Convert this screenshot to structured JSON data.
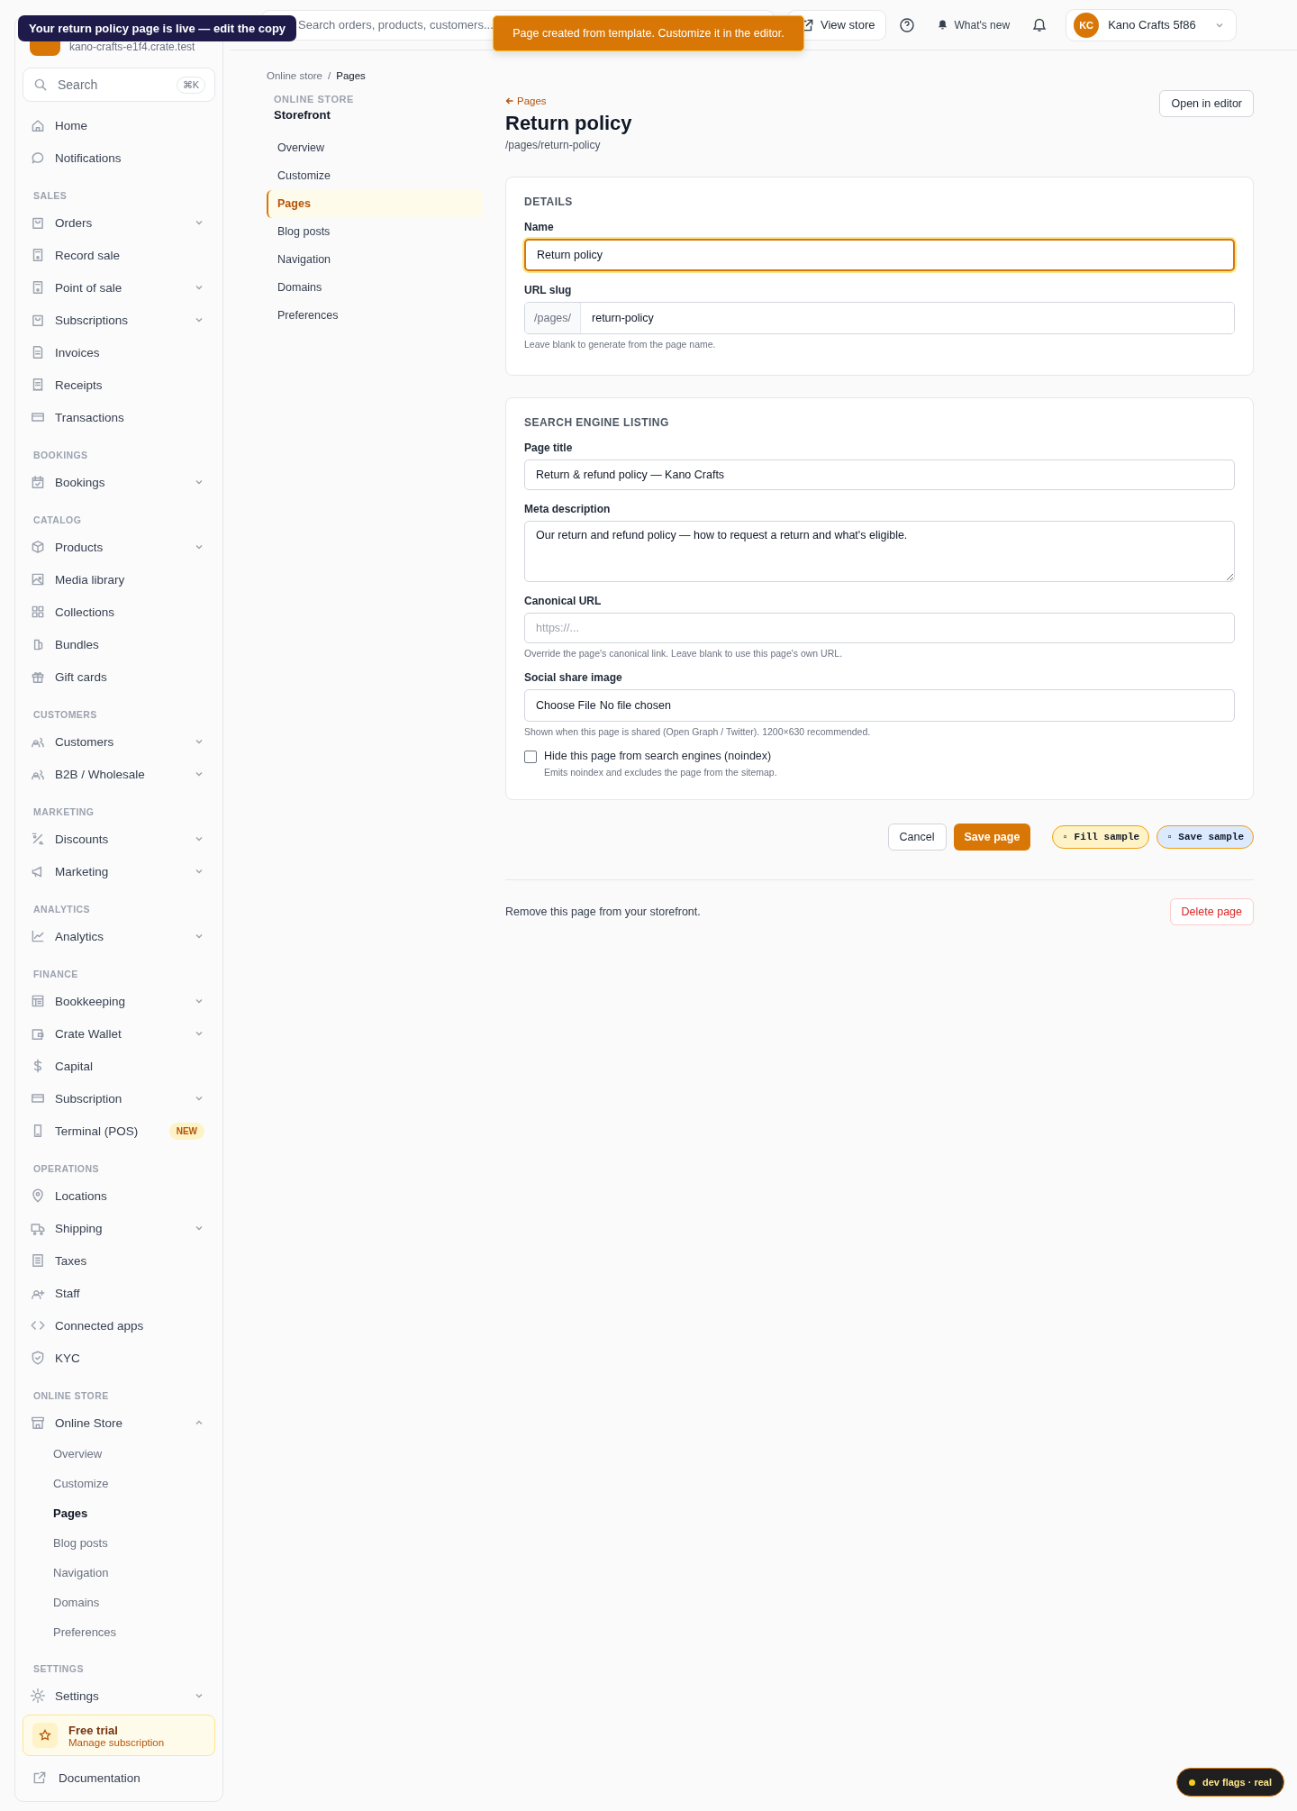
{
  "sidebar": {
    "store_url": "kano-crafts-e1f4.crate.test",
    "search": {
      "placeholder": "Search",
      "shortcut": "⌘K"
    },
    "items": [
      {
        "label": "Home",
        "kind": "link"
      },
      {
        "label": "Notifications",
        "kind": "link"
      }
    ],
    "sections": [
      {
        "title": "SALES",
        "items": [
          {
            "label": "Orders",
            "kind": "menu",
            "expanded": false
          },
          {
            "label": "Record sale",
            "kind": "link"
          },
          {
            "label": "Point of sale",
            "kind": "menu",
            "expanded": false
          },
          {
            "label": "Subscriptions",
            "kind": "menu",
            "expanded": false
          },
          {
            "label": "Invoices",
            "kind": "link"
          },
          {
            "label": "Receipts",
            "kind": "link"
          },
          {
            "label": "Transactions",
            "kind": "link"
          }
        ]
      },
      {
        "title": "BOOKINGS",
        "items": [
          {
            "label": "Bookings",
            "kind": "menu",
            "expanded": false
          }
        ]
      },
      {
        "title": "CATALOG",
        "items": [
          {
            "label": "Products",
            "kind": "menu",
            "expanded": false
          },
          {
            "label": "Media library",
            "kind": "link"
          },
          {
            "label": "Collections",
            "kind": "link"
          },
          {
            "label": "Bundles",
            "kind": "link"
          },
          {
            "label": "Gift cards",
            "kind": "link"
          }
        ]
      },
      {
        "title": "CUSTOMERS",
        "items": [
          {
            "label": "Customers",
            "kind": "menu",
            "expanded": false
          },
          {
            "label": "B2B / Wholesale",
            "kind": "menu",
            "expanded": false
          }
        ]
      },
      {
        "title": "MARKETING",
        "items": [
          {
            "label": "Discounts",
            "kind": "menu",
            "expanded": false
          },
          {
            "label": "Marketing",
            "kind": "menu",
            "expanded": false
          }
        ]
      },
      {
        "title": "ANALYTICS",
        "items": [
          {
            "label": "Analytics",
            "kind": "menu",
            "expanded": false
          }
        ]
      },
      {
        "title": "FINANCE",
        "items": [
          {
            "label": "Bookkeeping",
            "kind": "menu",
            "expanded": false
          },
          {
            "label": "Crate Wallet",
            "kind": "menu",
            "expanded": false
          },
          {
            "label": "Capital",
            "kind": "link"
          },
          {
            "label": "Subscription",
            "kind": "menu",
            "expanded": false
          },
          {
            "label": "Terminal (POS)",
            "kind": "link",
            "badge": "NEW"
          }
        ]
      },
      {
        "title": "OPERATIONS",
        "items": [
          {
            "label": "Locations",
            "kind": "link"
          },
          {
            "label": "Shipping",
            "kind": "menu",
            "expanded": false
          },
          {
            "label": "Taxes",
            "kind": "link"
          },
          {
            "label": "Staff",
            "kind": "link"
          },
          {
            "label": "Connected apps",
            "kind": "link"
          },
          {
            "label": "KYC",
            "kind": "link"
          }
        ]
      },
      {
        "title": "ONLINE STORE",
        "items": [
          {
            "label": "Online Store",
            "kind": "menu",
            "expanded": true,
            "children": [
              {
                "label": "Overview",
                "selected": false
              },
              {
                "label": "Customize",
                "selected": false
              },
              {
                "label": "Pages",
                "selected": true
              },
              {
                "label": "Blog posts",
                "selected": false
              },
              {
                "label": "Navigation",
                "selected": false
              },
              {
                "label": "Domains",
                "selected": false
              },
              {
                "label": "Preferences",
                "selected": false
              }
            ]
          }
        ]
      },
      {
        "title": "SETTINGS",
        "items": [
          {
            "label": "Settings",
            "kind": "menu",
            "expanded": false
          }
        ]
      }
    ],
    "trial": {
      "title": "Free trial",
      "link": "Manage subscription"
    },
    "documentation": "Documentation"
  },
  "header": {
    "search": {
      "placeholder": "Search orders, products, customers..."
    },
    "view_store": "View store",
    "whats_new": "What's new",
    "account": {
      "initials": "KC",
      "name": "Kano Crafts 5f86"
    }
  },
  "tooltip": "Your return policy page is live — edit the copy",
  "toast": "Page created from template. Customize it in the editor.",
  "breadcrumb": {
    "items": [
      "Online store",
      "Pages"
    ],
    "separator": "/"
  },
  "subnav": {
    "eyebrow": "ONLINE STORE",
    "title": "Storefront",
    "items": [
      {
        "label": "Overview",
        "selected": false
      },
      {
        "label": "Customize",
        "selected": false
      },
      {
        "label": "Pages",
        "selected": true
      },
      {
        "label": "Blog posts",
        "selected": false
      },
      {
        "label": "Navigation",
        "selected": false
      },
      {
        "label": "Domains",
        "selected": false
      },
      {
        "label": "Preferences",
        "selected": false
      }
    ]
  },
  "page": {
    "back": "Pages",
    "title": "Return policy",
    "path": "/pages/return-policy",
    "open_editor": "Open in editor"
  },
  "cards": [
    {
      "title": "DETAILS",
      "fields": [
        {
          "kind": "text",
          "label": "Name",
          "value": "Return policy",
          "focused": true
        },
        {
          "kind": "prefixed",
          "label": "URL slug",
          "prefix": "/pages/",
          "value": "return-policy",
          "focused": false,
          "help": "Leave blank to generate from the page name."
        }
      ]
    },
    {
      "title": "SEARCH ENGINE LISTING",
      "fields": [
        {
          "kind": "text",
          "label": "Page title",
          "value": "Return & refund policy — Kano Crafts",
          "focused": false
        },
        {
          "kind": "textarea",
          "label": "Meta description",
          "value": "Our return and refund policy — how to request a return and what's eligible.",
          "focused": false
        },
        {
          "kind": "text",
          "label": "Canonical URL",
          "placeholder": "https://...",
          "focused": false,
          "help": "Override the page's canonical link. Leave blank to use this page's own URL."
        },
        {
          "kind": "file",
          "label": "Social share image",
          "button": "Choose File",
          "value": "No file chosen",
          "focused": false,
          "help": "Shown when this page is shared (Open Graph / Twitter). 1200×630 recommended."
        },
        {
          "kind": "checkbox",
          "label": "Hide this page from search engines (noindex)",
          "help": "Emits noindex and excludes the page from the sitemap.",
          "checked": false
        }
      ]
    }
  ],
  "actions": {
    "cancel": "Cancel",
    "save": "Save page",
    "dev_buttons": [
      {
        "label": "▫ Fill sample",
        "kind": "fill"
      },
      {
        "label": "▫ Save sample",
        "kind": "save"
      }
    ]
  },
  "danger": {
    "text": "Remove this page from your storefront.",
    "button": "Delete page"
  },
  "dev_flags": "dev flags · real"
}
